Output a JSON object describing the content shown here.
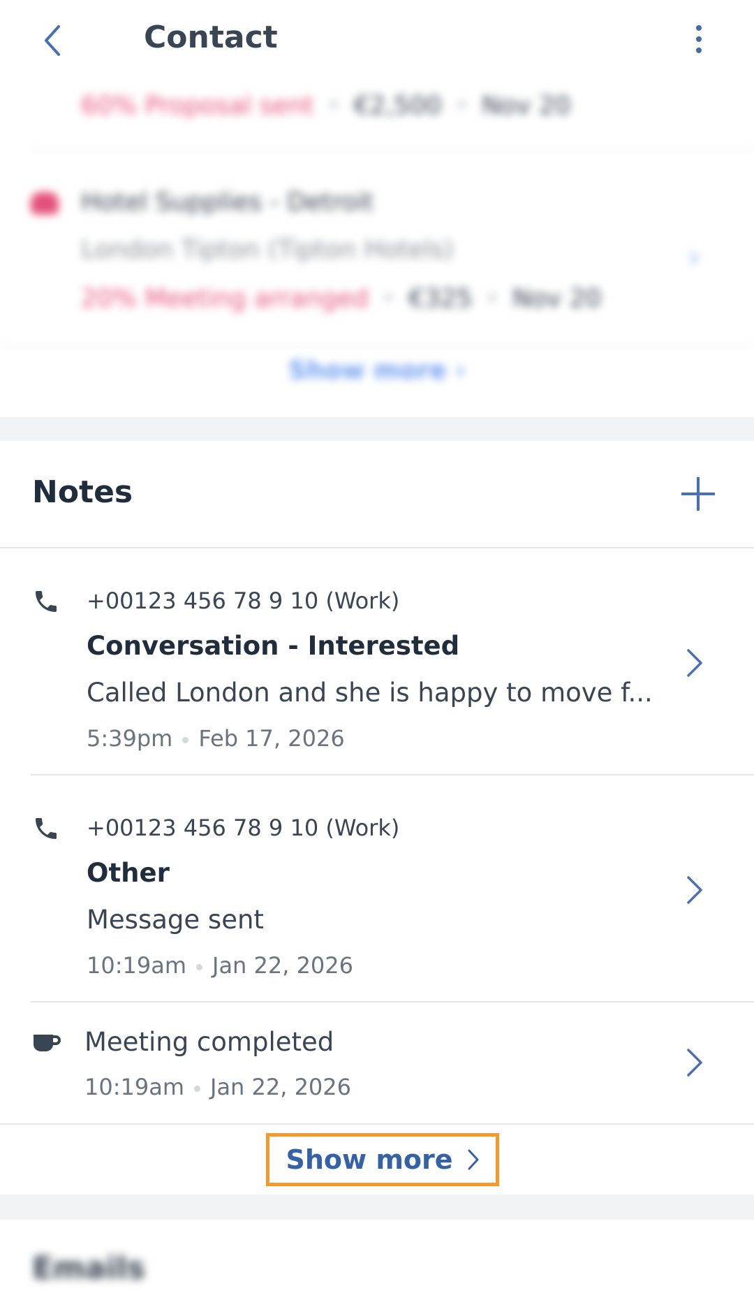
{
  "header": {
    "title": "Contact",
    "back_icon": "chevron-left-icon",
    "menu_icon": "more-vertical-icon"
  },
  "deals": {
    "deal1": {
      "stage": "60% Proposal sent",
      "amount": "€2,500",
      "date": "Nov 20"
    },
    "deal2": {
      "name": "Hotel Supplies - Detroit",
      "contact": "London Tipton (Tipton Hotels)",
      "stage": "20% Meeting arranged",
      "amount": "€325",
      "date": "Nov 20"
    },
    "show_more": "Show more"
  },
  "notes": {
    "title": "Notes",
    "items": [
      {
        "icon": "phone-icon",
        "phone": "+00123 456 78 9 10 (Work)",
        "subject": "Conversation - Interested",
        "body": "Called London and she is happy to move f...",
        "time": "5:39pm",
        "date": "Feb 17, 2026"
      },
      {
        "icon": "phone-icon",
        "phone": "+00123 456 78 9 10 (Work)",
        "subject": "Other",
        "body": "Message sent",
        "time": "10:19am",
        "date": "Jan 22, 2026"
      },
      {
        "icon": "coffee-cup-icon",
        "body": "Meeting completed",
        "time": "10:19am",
        "date": "Jan 22, 2026"
      }
    ],
    "show_more": "Show more"
  },
  "emails": {
    "title": "Emails"
  },
  "colors": {
    "accent": "#3561a6",
    "highlight": "#f39a2b",
    "deal_stage": "#e4507a"
  }
}
